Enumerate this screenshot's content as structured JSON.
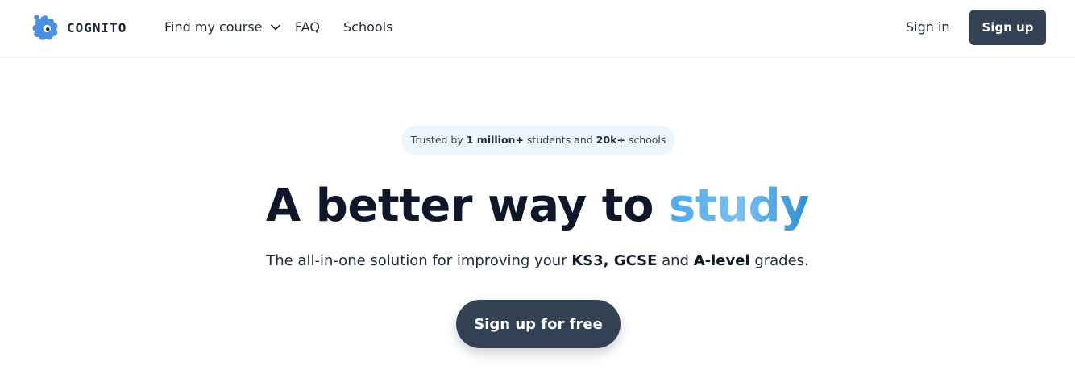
{
  "nav": {
    "brand": "COGNITO",
    "links": [
      {
        "label": "Find my course",
        "has_dropdown": true
      },
      {
        "label": "FAQ"
      },
      {
        "label": "Schools"
      }
    ],
    "sign_in": "Sign in",
    "sign_up": "Sign up"
  },
  "hero": {
    "badge": {
      "pre": "Trusted by ",
      "students": "1 million+",
      "mid": " students and ",
      "schools": "20k+",
      "post": " schools"
    },
    "headline": {
      "main": "A better way to ",
      "accent": "study"
    },
    "subheadline": {
      "pre": "The all-in-one solution for improving your ",
      "levels": "KS3, GCSE",
      "mid": " and ",
      "alevel": "A-level",
      "post": " grades."
    },
    "cta": "Sign up for free"
  },
  "colors": {
    "primary": "#334155",
    "accent": "#4aa8ec",
    "badge_bg": "#eaf5fd",
    "logo": "#4a90e2"
  },
  "icons": {
    "logo": "cognito-splat-logo-icon",
    "dropdown": "chevron-down-icon"
  }
}
